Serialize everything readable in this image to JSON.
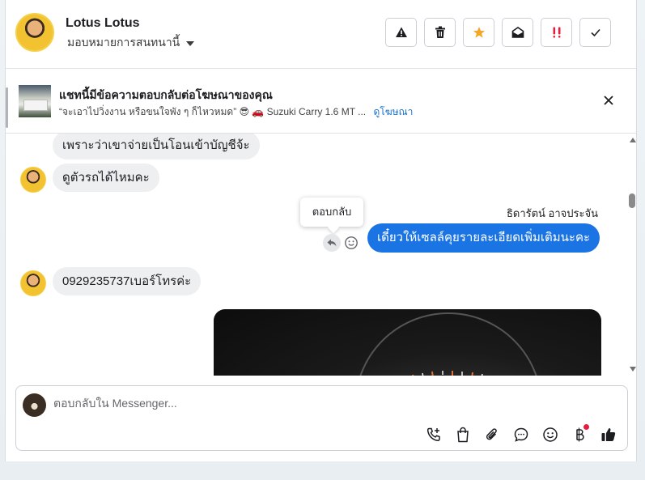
{
  "header": {
    "name": "Lotus Lotus",
    "assign_label": "มอบหมายการสนทนานี้",
    "toolbar": [
      {
        "name": "report-button",
        "icon": "warning-icon"
      },
      {
        "name": "delete-button",
        "icon": "trash-icon"
      },
      {
        "name": "star-button",
        "icon": "star-icon"
      },
      {
        "name": "mark-unread-button",
        "icon": "envelope-open-icon"
      },
      {
        "name": "priority-button",
        "icon": "double-exclamation-icon"
      },
      {
        "name": "done-button",
        "icon": "checkmark-icon"
      }
    ]
  },
  "banner": {
    "title": "แชทนี้มีข้อความตอบกลับต่อโฆษณาของคุณ",
    "subtitle": "“จะเอาไปวิ่งงาน หรือขนใจพัง ๆ ก็ไหวหมด” 😎 🚗 Suzuki Carry 1.6 MT ...",
    "link": "ดูโฆษณา"
  },
  "messages": {
    "m1": "เพราะว่าเขาจ่ายเป็นโอนเข้าบัญชีจ้ะ",
    "m2": "ดูตัวรถได้ไหมคะ",
    "sender_name": "ธิดารัตน์ อาจประจัน",
    "outgoing": "เดี๋ยวให้เซลล์คุยรายละเอียดเพิ่มเติมนะคะ",
    "tooltip": "ตอบกลับ",
    "m3": "0929235737เบอร์โทรค่ะ"
  },
  "composer": {
    "placeholder": "ตอบกลับใน Messenger..."
  },
  "colors": {
    "accent": "#1b74e4",
    "star": "#f5a623",
    "priority": "#e41e3f"
  }
}
